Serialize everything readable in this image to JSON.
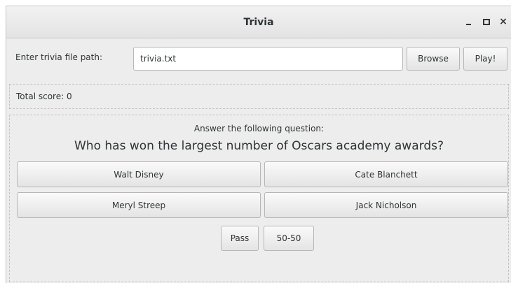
{
  "window": {
    "title": "Trivia",
    "controls": {
      "minimize": "minimize",
      "maximize": "maximize",
      "close": "×"
    }
  },
  "file_row": {
    "label": "Enter trivia file path:",
    "path_value": "trivia.txt",
    "browse_label": "Browse",
    "play_label": "Play!"
  },
  "score": {
    "text": "Total score:  0"
  },
  "quiz": {
    "instruction": "Answer the following question:",
    "question": "Who has won the largest number of Oscars academy awards?",
    "answers": [
      "Walt Disney",
      "Cate Blanchett",
      "Meryl Streep",
      "Jack Nicholson"
    ],
    "pass_label": "Pass",
    "fifty_label": "50-50"
  }
}
